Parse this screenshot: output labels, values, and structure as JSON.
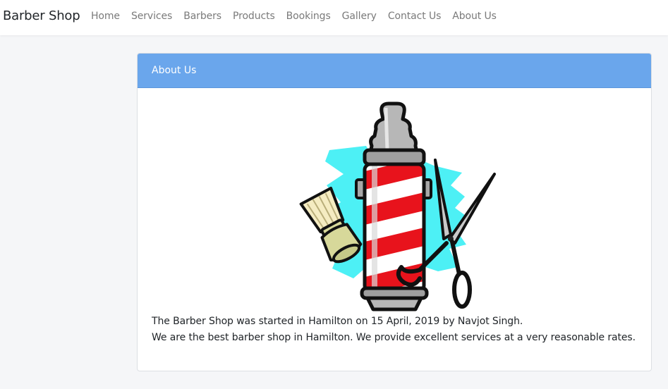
{
  "brand": "Barber Shop",
  "nav": {
    "items": [
      "Home",
      "Services",
      "Barbers",
      "Products",
      "Bookings",
      "Gallery",
      "Contact Us",
      "About Us"
    ]
  },
  "card": {
    "header": "About Us",
    "line1": "The Barber Shop was started in Hamilton on 15 April, 2019 by Navjot Singh.",
    "line2": "We are the best barber shop in Hamilton. We provide excellent services at a very reasonable rates."
  },
  "colors": {
    "header_bg": "#6aa6ec",
    "pole_red": "#e8131c",
    "splash_cyan": "#4df0f5"
  },
  "illustration": {
    "icon": "barber-pole-icon"
  }
}
